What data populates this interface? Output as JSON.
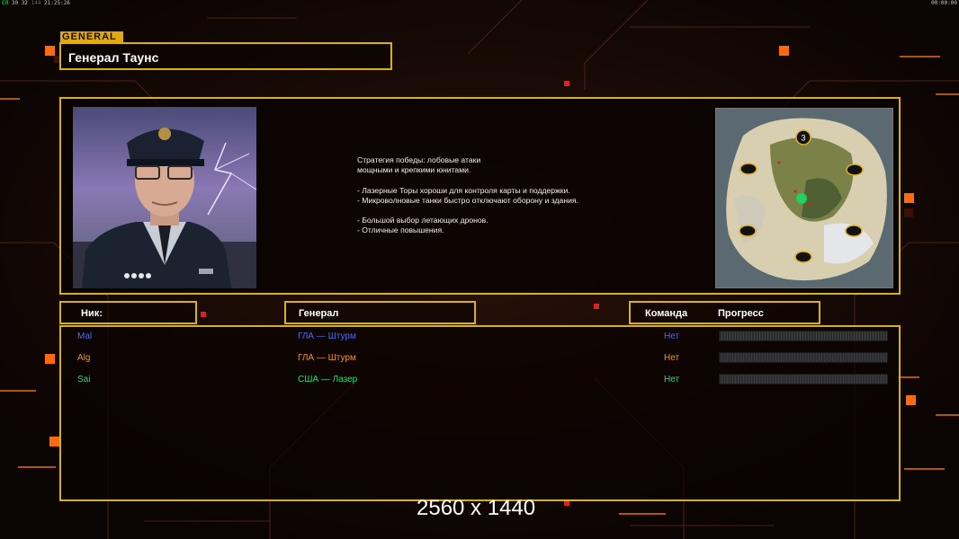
{
  "status_bar": {
    "left_prefix": "ЕЯ",
    "left_values": "30 32",
    "left_dim": "144",
    "time": "21:25:26",
    "right_time": "00:00:00"
  },
  "general": {
    "tag": "GENERAL",
    "name": "Генерал Таунс",
    "description": [
      "Стратегия победы: лобовые атаки",
      "мощными и крепкими юнитами.",
      "",
      "- Лазерные Торы хороши для контроля карты и поддержки.",
      "- Микроволновые танки быстро отключают оборону и здания.",
      "",
      "- Большой выбор летающих дронов.",
      "- Отличные повышения."
    ]
  },
  "map": {
    "start_marker": "3"
  },
  "table": {
    "headers": {
      "nick": "Ник:",
      "general": "Генерал",
      "team": "Команда",
      "progress": "Прогресс"
    },
    "rows": [
      {
        "nick": "Mal",
        "general": "ГЛА — Штурм",
        "team": "Нет",
        "color": "#4a6cf0",
        "progress": 0
      },
      {
        "nick": "Alg",
        "general": "ГЛА — Штурм",
        "team": "Нет",
        "color": "#e89630",
        "progress": 0
      },
      {
        "nick": "Sai",
        "general": "США — Лазер",
        "team": "Нет",
        "color": "#38d870",
        "progress": 0
      }
    ]
  },
  "overlay": {
    "resolution": "2560 x 1440"
  },
  "colors": {
    "frame": "#d9b211",
    "accent_orange": "#ff6a10",
    "background": "#0d0604"
  }
}
